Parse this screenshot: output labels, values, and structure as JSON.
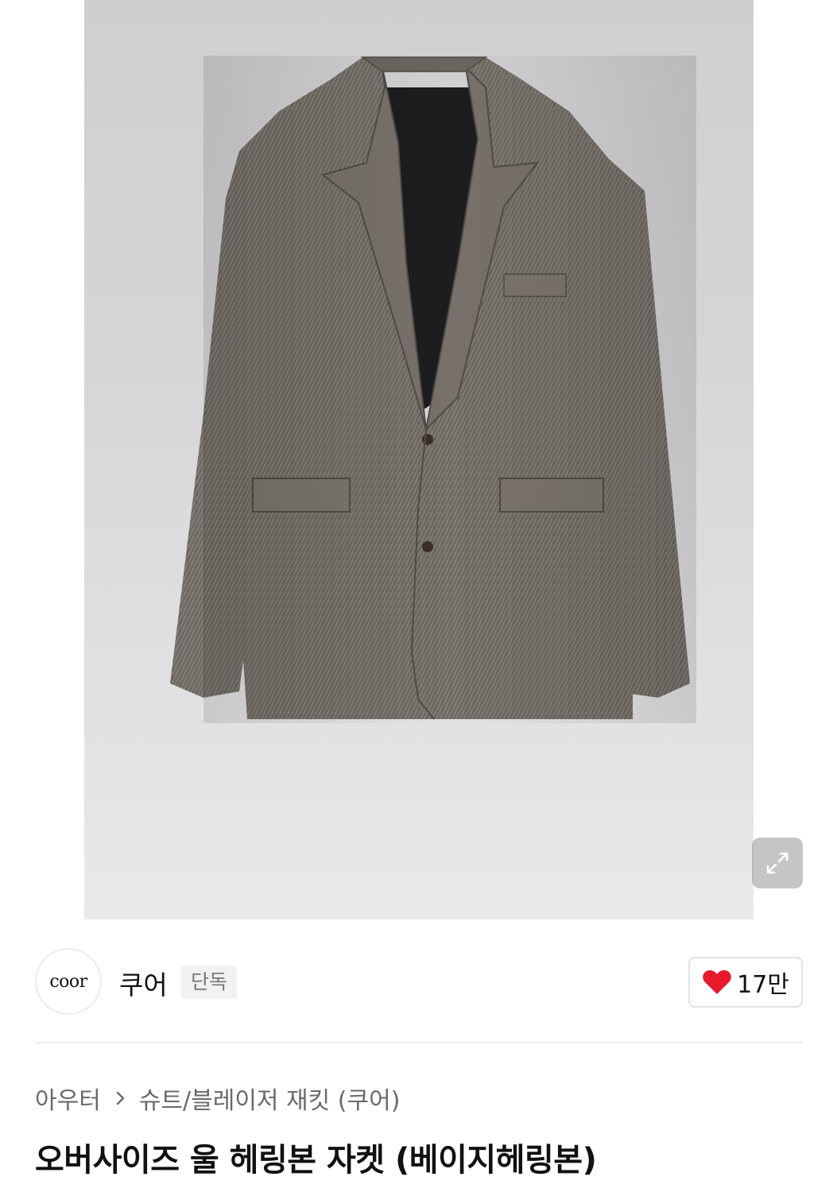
{
  "product": {
    "image_alt": "herringbone-wool-jacket-photo",
    "title": "오버사이즈 울 헤링본 자켓 (베이지헤링본)"
  },
  "gallery": {
    "expand_icon": "expand-icon"
  },
  "brand": {
    "logo_text": "coor",
    "name": "쿠어",
    "badge": "단독"
  },
  "like": {
    "icon": "heart-icon",
    "count": "17만",
    "heart_color": "#e8192c"
  },
  "breadcrumb": {
    "items": [
      "아우터",
      "슈트/블레이저 재킷 (쿠어)"
    ]
  }
}
